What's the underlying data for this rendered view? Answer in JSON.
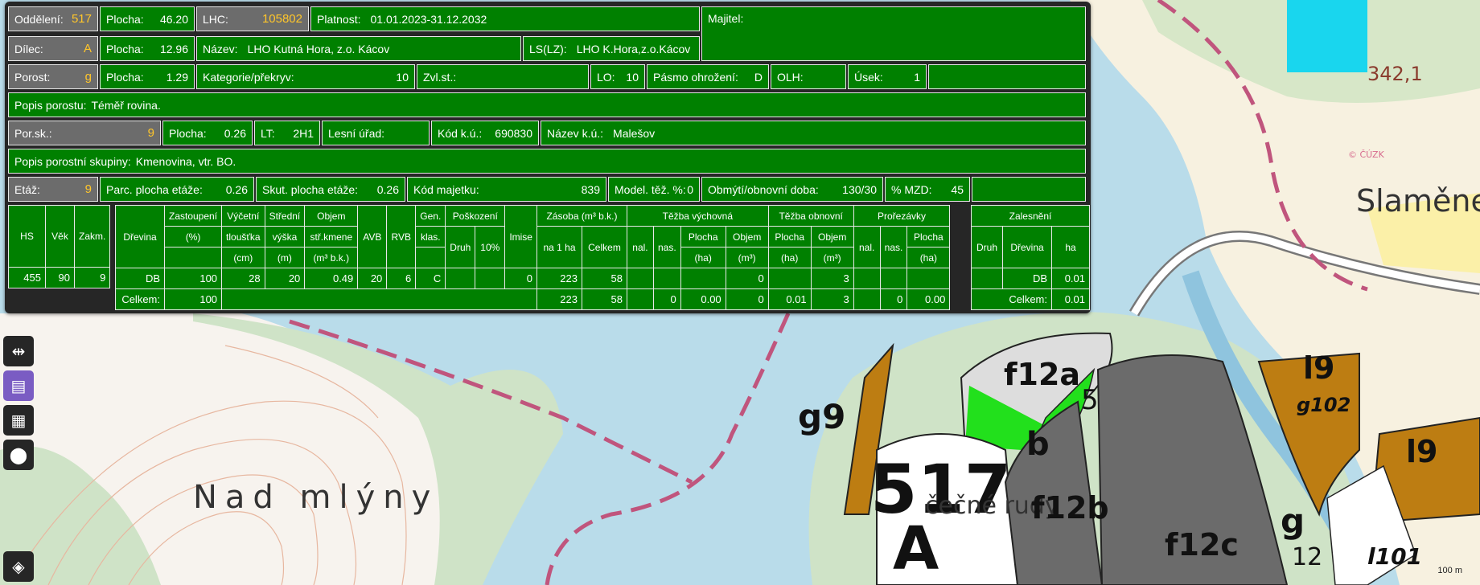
{
  "header": {
    "row1": {
      "oddeleni_label": "Oddělení:",
      "oddeleni": "517",
      "plocha_label": "Plocha:",
      "plocha": "46.20",
      "lhc_label": "LHC:",
      "lhc": "105802",
      "platnost_label": "Platnost:",
      "platnost": "01.01.2023-31.12.2032",
      "majitel_label": "Majitel:"
    },
    "row2": {
      "dilec_label": "Dílec:",
      "dilec": "A",
      "plocha_label": "Plocha:",
      "plocha": "12.96",
      "nazev_label": "Název:",
      "nazev": "LHO Kutná Hora, z.o. Kácov",
      "ls_label": "LS(LZ):",
      "ls": "LHO K.Hora,z.o.Kácov"
    },
    "row3": {
      "porost_label": "Porost:",
      "porost": "g",
      "plocha_label": "Plocha:",
      "plocha": "1.29",
      "kategorie_label": "Kategorie/překryv:",
      "kategorie": "10",
      "zvl_label": "Zvl.st.:",
      "lo_label": "LO:",
      "lo": "10",
      "pasmo_label": "Pásmo ohrožení:",
      "pasmo": "D",
      "olh_label": "OLH:",
      "usek_label": "Úsek:",
      "usek": "1"
    },
    "row4": {
      "label": "Popis porostu:",
      "value": "Téměř rovina."
    },
    "row5": {
      "porsk_label": "Por.sk.:",
      "porsk": "9",
      "plocha_label": "Plocha:",
      "plocha": "0.26",
      "lt_label": "LT:",
      "lt": "2H1",
      "lesni_urad_label": "Lesní úřad:",
      "kodku_label": "Kód k.ú.:",
      "kodku": "690830",
      "nazevku_label": "Název k.ú.:",
      "nazevku": "Malešov"
    },
    "row6": {
      "label": "Popis porostní skupiny:",
      "value": "Kmenovina, vtr. BO."
    },
    "row7": {
      "etaz_label": "Etáž:",
      "etaz": "9",
      "parc_label": "Parc. plocha etáže:",
      "parc": "0.26",
      "skut_label": "Skut. plocha etáže:",
      "skut": "0.26",
      "kodmaj_label": "Kód majetku:",
      "kodmaj": "839",
      "model_label": "Model. těž. %:",
      "model": "0",
      "obmyti_label": "Obmýtí/obnovní doba:",
      "obmyti": "130/30",
      "mzd_label": "% MZD:",
      "mzd": "45"
    }
  },
  "table": {
    "h": {
      "hs": "HS",
      "vek": "Věk",
      "zakm": "Zakm.",
      "drevina": "Dřevina",
      "zast1": "Zastoupení",
      "zast2": "(%)",
      "vyc1": "Výčetní",
      "vyc2": "tloušťka",
      "vyc3": "(cm)",
      "str1": "Střední",
      "str2": "výška",
      "str3": "(m)",
      "obj1": "Objem",
      "obj2": "stř.kmene",
      "obj3": "(m³ b.k.)",
      "avb": "AVB",
      "rvb": "RVB",
      "gen1": "Gen.",
      "gen2": "klas.",
      "posk": "Poškození",
      "druh": "Druh",
      "p10": "10%",
      "imise": "Imise",
      "zasoba": "Zásoba (m³ b.k.)",
      "na1ha": "na 1 ha",
      "celkem": "Celkem",
      "tv": "Těžba výchovná",
      "nal": "nal.",
      "nas": "nas.",
      "plocha1": "Plocha",
      "ha": "(ha)",
      "objem1": "Objem",
      "m3": "(m³)",
      "to": "Těžba obnovní",
      "prorez": "Prořezávky",
      "zales": "Zalesnění",
      "hadr": "ha"
    },
    "row": {
      "hs": "455",
      "vek": "90",
      "zakm": "9",
      "drevina": "DB",
      "zast": "100",
      "vyc": "28",
      "str": "20",
      "obj": "0.49",
      "avb": "20",
      "rvb": "6",
      "gen": "C",
      "imise": "0",
      "na1ha": "223",
      "celkem": "58",
      "tv_objem": "0",
      "to_objem": "3",
      "zal_drevina": "DB",
      "zal_ha": "0.01"
    },
    "total": {
      "label": "Celkem:",
      "zast": "100",
      "na1ha": "223",
      "celkem": "58",
      "tv_nas": "0",
      "tv_plocha": "0.00",
      "tv_objem": "0",
      "to_plocha": "0.01",
      "to_objem": "3",
      "pr_nas": "0",
      "pr_plocha": "0.00",
      "zal_label": "Celkem:",
      "zal_ha": "0.01"
    }
  },
  "map": {
    "labels": {
      "nad_mlyny": "Nad mlýny",
      "slamenec": "Slaměnec",
      "elev": "342,1",
      "cuzk": "© ČÚZK",
      "big_num": "517",
      "big_letter": "A",
      "cesne_rudy": "čečné rudy",
      "f12a": "f12a",
      "f12b": "f12b",
      "f12c": "f12c",
      "g9": "g9",
      "b": "b",
      "five": "5",
      "l9a": "l9",
      "l9b": "l9",
      "g102": "g102",
      "g12": "g",
      "g12n": "12",
      "l101": "l101",
      "scale": "100 m"
    }
  },
  "colors": {
    "panel_green": "#008000",
    "label_gray": "#6c6c6c",
    "value_yellow": "#ffc62a",
    "toolbar": "#262626",
    "active_tool": "#7a5cc3"
  }
}
